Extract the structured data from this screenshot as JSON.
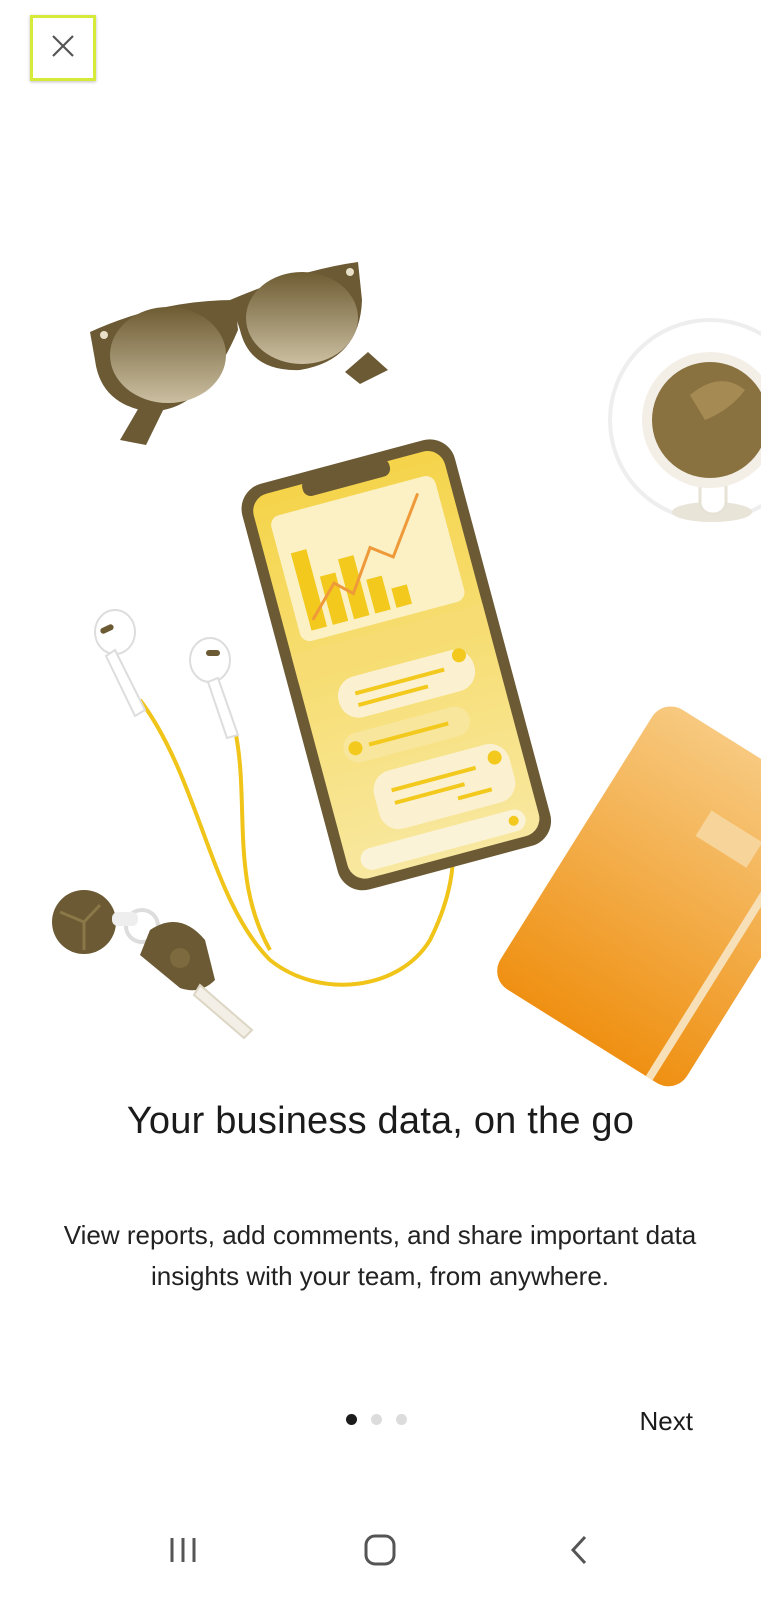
{
  "header": {
    "close_icon": "close-icon"
  },
  "onboarding": {
    "title": "Your business data, on the go",
    "description": "View reports, add comments, and share important data insights with your team, from anywhere.",
    "page_indicator": {
      "total": 3,
      "current": 1
    },
    "next_label": "Next"
  },
  "illustration": {
    "items": [
      "sunglasses",
      "phone-with-chart",
      "earphones",
      "coffee-cup",
      "notebook",
      "car-keys"
    ]
  },
  "system_nav": {
    "icons": [
      "recent-apps-icon",
      "home-icon",
      "back-icon"
    ]
  },
  "colors": {
    "highlight_border": "#d6ea3a",
    "accent_yellow": "#f2c91c",
    "brown": "#6b5a34",
    "orange": "#f19a1a"
  }
}
